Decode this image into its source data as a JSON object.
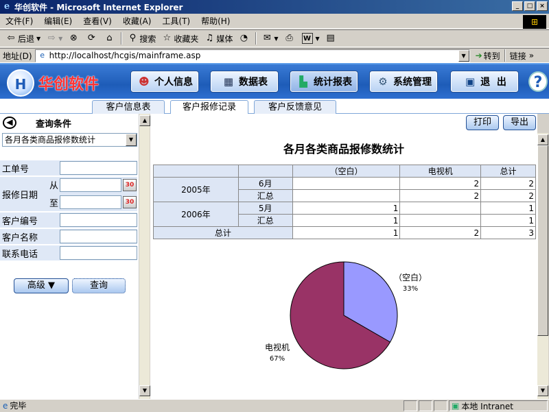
{
  "window": {
    "title": "华创软件 - Microsoft Internet Explorer"
  },
  "menu": [
    "文件(F)",
    "编辑(E)",
    "查看(V)",
    "收藏(A)",
    "工具(T)",
    "帮助(H)"
  ],
  "toolbar": {
    "back": "后退",
    "search": "搜索",
    "favorites": "收藏夹",
    "media": "媒体"
  },
  "address": {
    "label": "地址(D)",
    "url": "http://localhost/hcgis/mainframe.asp",
    "go": "转到",
    "links": "链接"
  },
  "header": {
    "brand": "华创软件",
    "buttons": [
      "个人信息",
      "数据表",
      "统计报表",
      "系统管理",
      "退  出"
    ]
  },
  "tabs": [
    "客户信息表",
    "客户报修记录",
    "客户反馈意见"
  ],
  "query": {
    "title": "查询条件",
    "selected": "各月各类商品报修数统计",
    "fields": {
      "order_no": "工单号",
      "repair_date": "报修日期",
      "from": "从",
      "to": "至",
      "customer_no": "客户编号",
      "customer_name": "客户名称",
      "phone": "联系电话"
    },
    "advanced": "高级 ▼",
    "search": "查询"
  },
  "report": {
    "print": "打印",
    "export": "导出",
    "title": "各月各类商品报修数统计",
    "columns": [
      "（空白）",
      "电视机",
      "总计"
    ],
    "rows": [
      {
        "year": "2005年",
        "sub": "6月",
        "blank": "",
        "tv": "2",
        "total": "2"
      },
      {
        "year": "",
        "sub": "汇总",
        "blank": "",
        "tv": "2",
        "total": "2"
      },
      {
        "year": "2006年",
        "sub": "5月",
        "blank": "1",
        "tv": "",
        "total": "1"
      },
      {
        "year": "",
        "sub": "汇总",
        "blank": "1",
        "tv": "",
        "total": "1"
      }
    ],
    "grand_total": {
      "label": "总计",
      "blank": "1",
      "tv": "2",
      "total": "3"
    }
  },
  "chart_data": {
    "type": "pie",
    "categories": [
      "（空白）",
      "电视机"
    ],
    "values": [
      1,
      2
    ],
    "percent_labels": [
      "33%",
      "67%"
    ],
    "colors": [
      "#9999ff",
      "#993366"
    ]
  },
  "status": {
    "text": "完毕",
    "zone": "本地 Intranet"
  }
}
